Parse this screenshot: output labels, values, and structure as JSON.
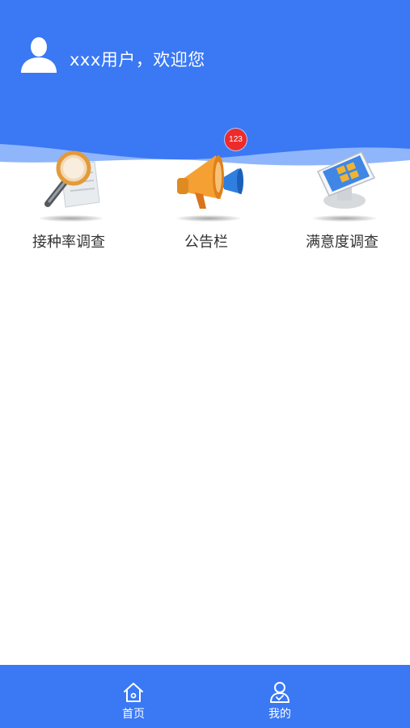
{
  "header": {
    "greeting": "xxx用户，欢迎您",
    "avatar_icon": "user-silhouette-icon",
    "background_color": "#3a78f4"
  },
  "features": [
    {
      "label": "接种率调查",
      "icon": "magnifier-document-icon"
    },
    {
      "label": "公告栏",
      "icon": "megaphone-icon",
      "badge": "123"
    },
    {
      "label": "满意度调查",
      "icon": "tablet-survey-icon"
    }
  ],
  "tabbar": {
    "items": [
      {
        "label": "首页",
        "icon": "home-icon"
      },
      {
        "label": "我的",
        "icon": "profile-icon"
      }
    ],
    "background_color": "#3a78f4"
  },
  "colors": {
    "primary": "#3a78f4",
    "badge": "#ee2b2b"
  }
}
